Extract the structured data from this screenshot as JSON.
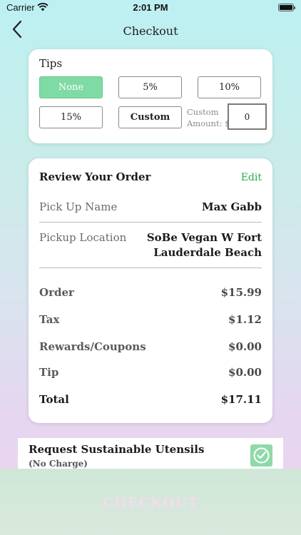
{
  "status_bar": {
    "carrier": "Carrier",
    "time": "2:01 PM"
  },
  "nav": {
    "title": "Checkout",
    "back_icon": "chevron-left-icon"
  },
  "tips": {
    "title": "Tips",
    "options": [
      "None",
      "5%",
      "10%",
      "15%",
      "Custom"
    ],
    "selected": "None",
    "custom_amount_label_line1": "Custom",
    "custom_amount_label_line2": "Amount: $",
    "custom_amount_value": "0"
  },
  "review": {
    "title": "Review Your Order",
    "edit_label": "Edit",
    "pickup_name_label": "Pick Up Name",
    "pickup_name_value": "Max Gabb",
    "pickup_location_label": "Pickup Location",
    "pickup_location_value_line1": "SoBe Vegan W Fort",
    "pickup_location_value_line2": "Lauderdale Beach",
    "summary": [
      {
        "label": "Order",
        "value": "$15.99"
      },
      {
        "label": "Tax",
        "value": "$1.12"
      },
      {
        "label": "Rewards/Coupons",
        "value": "$0.00"
      },
      {
        "label": "Tip",
        "value": "$0.00"
      }
    ],
    "total_label": "Total",
    "total_value": "$17.11"
  },
  "utensils": {
    "title": "Request Sustainable Utensils",
    "subtitle": "(No Charge)",
    "checked": true
  },
  "checkout": {
    "label": "CHECKOUT"
  },
  "colors": {
    "accent_green": "#7fdba4",
    "edit_green": "#2aa84f",
    "checkbox_green": "#8fd9a9"
  }
}
